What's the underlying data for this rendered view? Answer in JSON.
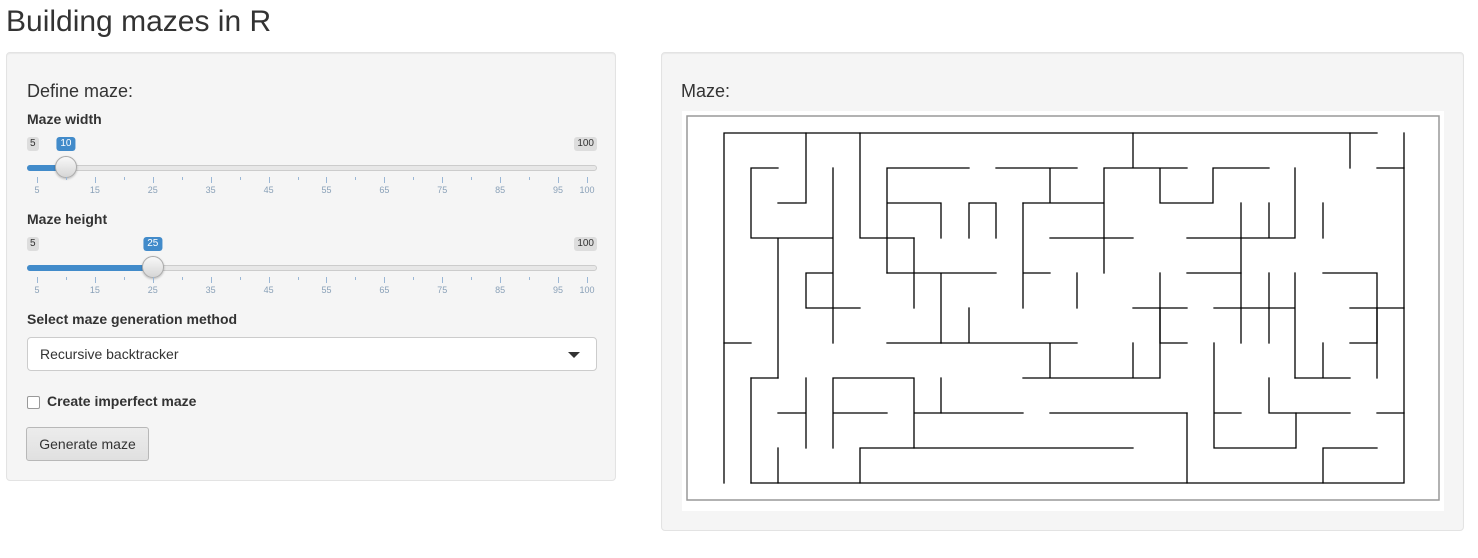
{
  "page": {
    "title": "Building mazes in R"
  },
  "form": {
    "heading": "Define maze:",
    "width_slider": {
      "label": "Maze width",
      "min": 5,
      "max": 100,
      "value": 10,
      "tick_labels": [
        "5",
        "15",
        "25",
        "35",
        "45",
        "55",
        "65",
        "75",
        "85",
        "95",
        "100"
      ]
    },
    "height_slider": {
      "label": "Maze height",
      "min": 5,
      "max": 100,
      "value": 25,
      "tick_labels": [
        "5",
        "15",
        "25",
        "35",
        "45",
        "55",
        "65",
        "75",
        "85",
        "95",
        "100"
      ]
    },
    "method": {
      "label": "Select maze generation method",
      "selected": "Recursive backtracker"
    },
    "imperfect": {
      "label": "Create imperfect maze",
      "checked": false
    },
    "generate_button": "Generate maze"
  },
  "output": {
    "heading": "Maze:"
  },
  "colors": {
    "accent": "#428bca",
    "panel_bg": "#f5f5f5",
    "maze_line": "#000000"
  }
}
